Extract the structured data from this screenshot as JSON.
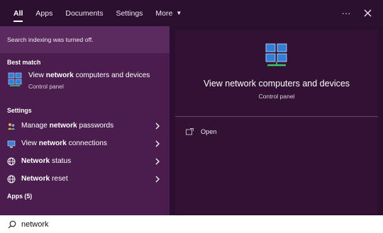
{
  "tabs": [
    {
      "label": "All",
      "active": true
    },
    {
      "label": "Apps"
    },
    {
      "label": "Documents"
    },
    {
      "label": "Settings"
    },
    {
      "label": "More",
      "dropdown": true
    }
  ],
  "topbar": {
    "more_options_icon": "ellipsis-icon",
    "close_icon": "close-icon"
  },
  "notice": "Search indexing was turned off.",
  "best_match": {
    "heading": "Best match",
    "title_pre": "View ",
    "title_bold": "network",
    "title_post": " computers and devices",
    "subtitle": "Control panel",
    "icon": "network-computers-icon"
  },
  "settings": {
    "heading": "Settings",
    "items": [
      {
        "pre": "Manage ",
        "bold": "network",
        "post": " passwords",
        "icon": "people-icon"
      },
      {
        "pre": "View ",
        "bold": "network",
        "post": " connections",
        "icon": "network-adapter-icon"
      },
      {
        "pre": "",
        "bold": "Network",
        "post": " status",
        "icon": "globe-icon"
      },
      {
        "pre": "",
        "bold": "Network",
        "post": " reset",
        "icon": "globe-icon"
      }
    ]
  },
  "apps_heading": "Apps (5)",
  "preview": {
    "title": "View network computers and devices",
    "subtitle": "Control panel",
    "actions": [
      {
        "label": "Open",
        "icon": "open-window-icon"
      }
    ]
  },
  "search": {
    "value": "network",
    "icon": "search-icon"
  },
  "colors": {
    "accent_bg": "#4a1d4e",
    "preview_bg": "#321134",
    "topbar_bg": "#2c1030"
  }
}
